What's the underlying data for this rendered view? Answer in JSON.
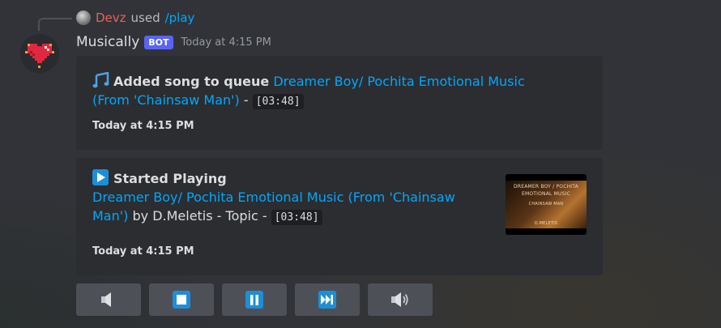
{
  "reply": {
    "user": "Devz",
    "used": "used",
    "command": "/play"
  },
  "message": {
    "username": "Musically",
    "bot_tag": "BOT",
    "timestamp": "Today at 4:15 PM"
  },
  "embed_queue": {
    "title": "Added song to queue",
    "song_link": "Dreamer Boy/ Pochita Emotional Music (From 'Chainsaw Man')",
    "separator": " - ",
    "duration": "[03:48]",
    "footer": "Today at 4:15 PM"
  },
  "embed_playing": {
    "title": "Started Playing",
    "song_link": "Dreamer Boy/ Pochita Emotional Music (From 'Chainsaw Man')",
    "by": " by ",
    "artist": "D.Meletis - Topic",
    "separator": " - ",
    "duration": "[03:48]",
    "footer": "Today at 4:15 PM",
    "thumbnail": {
      "line1": "DREAMER BOY / POCHITA",
      "line2": "EMOTIONAL MUSIC",
      "line3": "CHAINSAW MAN",
      "line4": "D.MELETIS"
    }
  },
  "buttons": [
    {
      "name": "volume-down-button",
      "icon": "speaker-low-icon"
    },
    {
      "name": "stop-button",
      "icon": "stop-icon"
    },
    {
      "name": "pause-button",
      "icon": "pause-icon"
    },
    {
      "name": "skip-button",
      "icon": "next-track-icon"
    },
    {
      "name": "volume-up-button",
      "icon": "speaker-high-icon"
    }
  ],
  "colors": {
    "background": "#313338",
    "embed": "#2b2d31",
    "link": "#00a8fc",
    "bot_tag": "#5865f2",
    "reply_user": "#e8634e",
    "button": "#4e5058",
    "icon_blue": "#1c8fd8"
  }
}
